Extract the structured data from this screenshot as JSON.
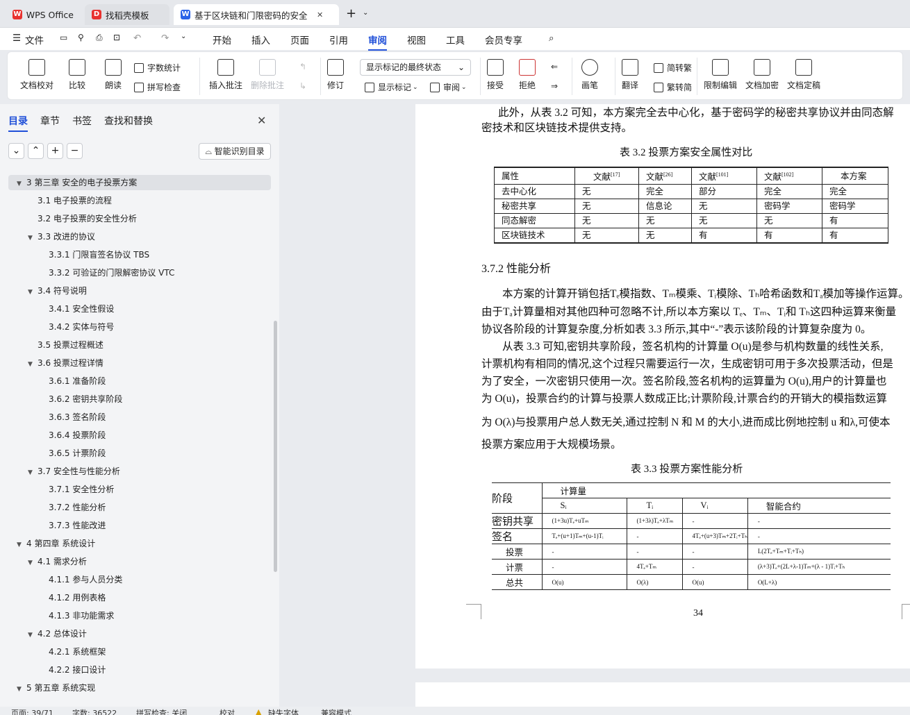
{
  "tabs": [
    {
      "label": "WPS Office",
      "icon": "wps-logo-icon"
    },
    {
      "label": "找稻壳模板",
      "icon": "docer-logo-icon"
    },
    {
      "label": "基于区块链和门限密码的安全",
      "icon": "writer-doc-icon"
    }
  ],
  "tab_add": "+",
  "menu": {
    "file": "文件",
    "items": [
      "开始",
      "插入",
      "页面",
      "引用",
      "审阅",
      "视图",
      "工具",
      "会员专享"
    ],
    "active": "审阅"
  },
  "ribbon": {
    "doc_proof": "文档校对",
    "compare": "比较",
    "read_aloud": "朗读",
    "word_count": "字数统计",
    "spell_check": "拼写检查",
    "insert_comment": "插入批注",
    "delete_comment": "删除批注",
    "track": "修订",
    "markup_state": "显示标记的最终状态",
    "show_markup": "显示标记",
    "review": "审阅",
    "accept": "接受",
    "reject": "拒绝",
    "pen": "画笔",
    "translate": "翻译",
    "to_traditional": "简转繁",
    "to_simplified": "繁转简",
    "restrict_edit": "限制编辑",
    "encrypt": "文档加密",
    "finalize": "文档定稿"
  },
  "nav": {
    "tabs": [
      "目录",
      "章节",
      "书签",
      "查找和替换"
    ],
    "smart_toc": "智能识别目录",
    "toc": [
      {
        "text": "3  第三章   安全的电子投票方案",
        "level": 0,
        "toggle": "down",
        "selected": true
      },
      {
        "text": "3.1  电子投票的流程",
        "level": 1
      },
      {
        "text": "3.2  电子投票的安全性分析",
        "level": 1
      },
      {
        "text": "3.3  改进的协议",
        "level": 1,
        "toggle": "down"
      },
      {
        "text": "3.3.1  门限盲签名协议 TBS",
        "level": 2
      },
      {
        "text": "3.3.2  可验证的门限解密协议 VTC",
        "level": 2
      },
      {
        "text": "3.4  符号说明",
        "level": 1,
        "toggle": "down"
      },
      {
        "text": "3.4.1  安全性假设",
        "level": 2
      },
      {
        "text": "3.4.2  实体与符号",
        "level": 2
      },
      {
        "text": "3.5  投票过程概述",
        "level": 1
      },
      {
        "text": "3.6  投票过程详情",
        "level": 1,
        "toggle": "down"
      },
      {
        "text": "3.6.1  准备阶段",
        "level": 2
      },
      {
        "text": "3.6.2  密钥共享阶段",
        "level": 2
      },
      {
        "text": "3.6.3  签名阶段",
        "level": 2
      },
      {
        "text": "3.6.4  投票阶段",
        "level": 2
      },
      {
        "text": "3.6.5  计票阶段",
        "level": 2
      },
      {
        "text": "3.7  安全性与性能分析",
        "level": 1,
        "toggle": "down"
      },
      {
        "text": "3.7.1  安全性分析",
        "level": 2
      },
      {
        "text": "3.7.2  性能分析",
        "level": 2
      },
      {
        "text": "3.7.3  性能改进",
        "level": 2
      },
      {
        "text": "4  第四章    系统设计",
        "level": 0,
        "toggle": "down"
      },
      {
        "text": "4.1  需求分析",
        "level": 1,
        "toggle": "down"
      },
      {
        "text": "4.1.1  参与人员分类",
        "level": 2
      },
      {
        "text": "4.1.2  用例表格",
        "level": 2
      },
      {
        "text": "4.1.3  非功能需求",
        "level": 2
      },
      {
        "text": "4.2  总体设计",
        "level": 1,
        "toggle": "down"
      },
      {
        "text": "4.2.1  系统框架",
        "level": 2
      },
      {
        "text": "4.2.2  接口设计",
        "level": 2
      },
      {
        "text": "5  第五章    系统实现",
        "level": 0,
        "toggle": "down"
      }
    ]
  },
  "doc": {
    "para1": [
      "此外，从表 3.2 可知，本方案完全去中心化，基于密码学的秘密共享协议并由同态解",
      "密技术和区块链技术提供支持。"
    ],
    "table1_caption": "表 3.2 投票方案安全属性对比",
    "table1": {
      "header": [
        "属性",
        "文献",
        "文献",
        "文献",
        "文献",
        "本方案"
      ],
      "refs": [
        "",
        "[17]",
        "[26]",
        "[101]",
        "[102]",
        ""
      ],
      "rows": [
        [
          "去中心化",
          "无",
          "完全",
          "部分",
          "完全",
          "完全"
        ],
        [
          "秘密共享",
          "无",
          "信息论",
          "无",
          "密码学",
          "密码学"
        ],
        [
          "同态解密",
          "无",
          "无",
          "无",
          "无",
          "有"
        ],
        [
          "区块链技术",
          "无",
          "无",
          "有",
          "有",
          "有"
        ]
      ]
    },
    "section": "3.7.2   性能分析",
    "para2": [
      "本方案的计算开销包括Tₑ模指数、Tₘ模乘、Tᵢ模除、Tₕ哈希函数和Tₐ模加等操作运算。",
      "由于Tₐ计算量相对其他四种可忽略不计,所以本方案以 Tₑ、Tₘ、Tᵢ和 Tₕ这四种运算来衡量",
      "协议各阶段的计算复杂度,分析如表 3.3 所示,其中“-”表示该阶段的计算复杂度为 0。",
      "从表 3.3 可知,密钥共享阶段，签名机构的计算量 O(u)是参与机构数量的线性关系,",
      "计票机构有相同的情况,这个过程只需要运行一次，生成密钥可用于多次投票活动，但是",
      "为了安全，一次密钥只使用一次。签名阶段,签名机构的运算量为 O(u),用户的计算量也",
      "为 O(u)，投票合约的计算与投票人数成正比;计票阶段,计票合约的开销大的模指数运算",
      "为 O(λ)与投票用户总人数无关,通过控制 N 和 M 的大小,进而成比例地控制 u 和λ,可使本",
      "投票方案应用于大规模场景。"
    ],
    "table2_caption": "表 3.3 投票方案性能分析",
    "table2": {
      "stage_label": "阶段",
      "compute_label": "计算量",
      "cols": [
        "Sᵢ",
        "Tᵢ",
        "Vᵢ",
        "智能合约"
      ],
      "rows": [
        {
          "stage": "密钥共享",
          "cells": [
            "(1+3u)Tₑ+uTₘ",
            "(1+3λ)Tₑ+λTₘ",
            "-",
            "-"
          ]
        },
        {
          "stage": "签名",
          "cells": [
            "Tₑ+(u+1)Tₘ+(u-1)Tᵢ",
            "-",
            "4Tₑ+(u+3)Tₘ+2Tᵢ+Tₕ",
            "-"
          ]
        },
        {
          "stage": "投票",
          "cells": [
            "-",
            "-",
            "-",
            "L(2Tₑ+Tₘ+Tᵢ+Tₕ)"
          ]
        },
        {
          "stage": "计票",
          "cells": [
            "-",
            "4Tₑ+Tₘ",
            "-",
            "(λ+3)Tₑ+(2L+λ-1)Tₘ+(λ - 1)Tᵢ+Tₕ"
          ]
        },
        {
          "stage": "总共",
          "cells": [
            "O(u)",
            "O(λ)",
            "O(u)",
            "O(L+λ)"
          ]
        }
      ]
    },
    "page_number": "34"
  },
  "status": {
    "page": "页面: 39/71",
    "words": "字数: 36522",
    "spell": "拼写检查: 关闭",
    "proof": "校对",
    "missing_font": "缺失字体",
    "compat": "兼容模式"
  }
}
